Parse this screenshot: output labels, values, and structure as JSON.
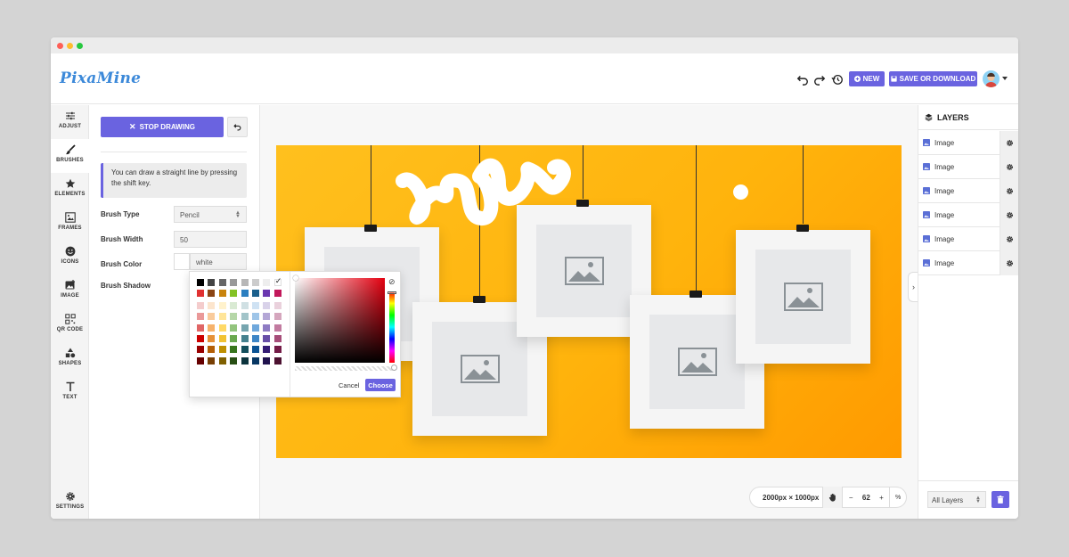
{
  "app": {
    "logo": "PixaMine"
  },
  "header": {
    "new_label": "NEW",
    "save_label": "SAVE OR DOWNLOAD"
  },
  "nav": {
    "items": [
      {
        "label": "ADJUST",
        "icon": "sliders-icon"
      },
      {
        "label": "BRUSHES",
        "icon": "brush-icon"
      },
      {
        "label": "ELEMENTS",
        "icon": "star-icon"
      },
      {
        "label": "FRAMES",
        "icon": "frame-icon"
      },
      {
        "label": "ICONS",
        "icon": "smiley-icon"
      },
      {
        "label": "IMAGE",
        "icon": "image-icon"
      },
      {
        "label": "QR CODE",
        "icon": "qr-icon"
      },
      {
        "label": "SHAPES",
        "icon": "shapes-icon"
      },
      {
        "label": "TEXT",
        "icon": "text-icon"
      }
    ],
    "settings_label": "SETTINGS",
    "active": "BRUSHES"
  },
  "brush_panel": {
    "stop_label": "STOP DRAWING",
    "tip": "You can draw a straight line by pressing the shift key.",
    "brush_type_label": "Brush Type",
    "brush_type_value": "Pencil",
    "brush_width_label": "Brush Width",
    "brush_width_value": "50",
    "brush_color_label": "Brush Color",
    "brush_color_value": "white",
    "brush_shadow_label": "Brush Shadow"
  },
  "color_picker": {
    "cancel_label": "Cancel",
    "choose_label": "Choose",
    "palette_rows": [
      [
        "#000000",
        "#444444",
        "#666666",
        "#999999",
        "#b7b7b7",
        "#cccccc",
        "#eeeeee",
        "#ffffff"
      ],
      [
        "#e03131",
        "#8b4513",
        "#c8830c",
        "#84c225",
        "#2b7fc0",
        "#1a5f8c",
        "#6b37b0",
        "#c2185b"
      ],
      [
        "#f4cccc",
        "#fce5cd",
        "#fff2cc",
        "#d9ead3",
        "#d0e0e3",
        "#cfe2f3",
        "#d9d2e9",
        "#ead1dc"
      ],
      [
        "#ea9999",
        "#f9cb9c",
        "#ffe599",
        "#b6d7a8",
        "#a2c4c9",
        "#9fc5e8",
        "#b4a7d6",
        "#d5a6bd"
      ],
      [
        "#e06666",
        "#f6b26b",
        "#ffd966",
        "#93c47d",
        "#76a5af",
        "#6fa8dc",
        "#8e7cc3",
        "#c27ba0"
      ],
      [
        "#cc0000",
        "#e69138",
        "#f1c232",
        "#6aa84f",
        "#45818e",
        "#3d85c6",
        "#674ea7",
        "#a64d79"
      ],
      [
        "#990000",
        "#b45f06",
        "#bf9000",
        "#38761d",
        "#134f5c",
        "#0b5394",
        "#351c75",
        "#741b47"
      ],
      [
        "#660000",
        "#783f04",
        "#7f6000",
        "#274e13",
        "#0c343d",
        "#073763",
        "#20124d",
        "#4c1130"
      ]
    ]
  },
  "canvas": {
    "size_label": "2000px × 1000px",
    "zoom_value": "62",
    "zoom_minus": "−",
    "zoom_plus": "+",
    "fit_label": "%"
  },
  "layers": {
    "title": "LAYERS",
    "items": [
      {
        "name": "Image"
      },
      {
        "name": "Image"
      },
      {
        "name": "Image"
      },
      {
        "name": "Image"
      },
      {
        "name": "Image"
      },
      {
        "name": "Image"
      }
    ],
    "filter_value": "All Layers"
  },
  "colors": {
    "accent": "#6a63e0",
    "canvas_orange": "#ffb30c"
  }
}
